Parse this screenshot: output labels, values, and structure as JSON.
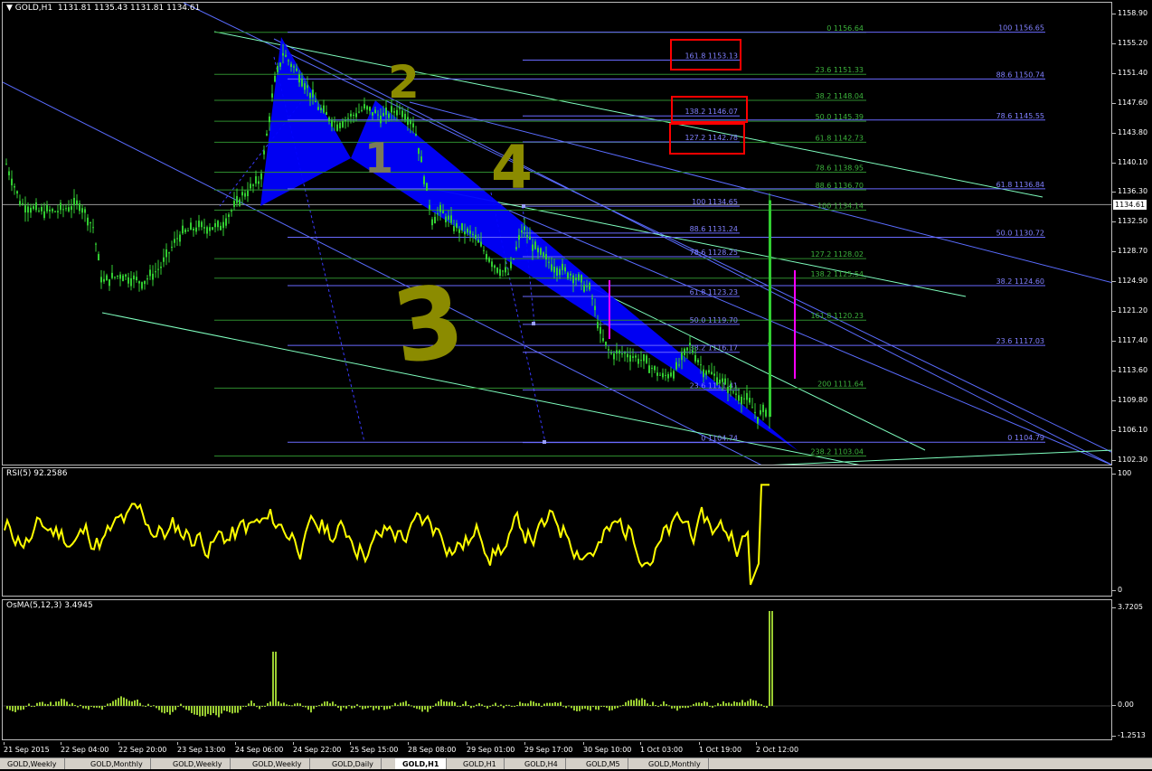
{
  "window": {
    "title": "GOLD,H1",
    "ohlc": "1131.81 1135.43 1131.81 1134.61"
  },
  "price_axis": {
    "ticks": [
      "1158.90",
      "1155.20",
      "1151.40",
      "1147.60",
      "1143.80",
      "1140.10",
      "1136.30",
      "1132.50",
      "1128.70",
      "1124.90",
      "1121.20",
      "1117.40",
      "1113.60",
      "1109.80",
      "1106.10",
      "1102.30"
    ],
    "current_price": "1134.61"
  },
  "rsi": {
    "title": "RSI(5) 92.2586",
    "max_label": "100",
    "min_label": "0",
    "color": "#ffff00"
  },
  "osma": {
    "title": "OsMA(5,12,3) 3.4945",
    "top_label": "3.7205",
    "zero_label": "0.00",
    "bottom_label": "-1.2513",
    "color": "#9acd32"
  },
  "time_axis": [
    "21 Sep 2015",
    "22 Sep 04:00",
    "22 Sep 20:00",
    "23 Sep 13:00",
    "24 Sep 06:00",
    "24 Sep 22:00",
    "25 Sep 15:00",
    "28 Sep 08:00",
    "29 Sep 01:00",
    "29 Sep 17:00",
    "30 Sep 10:00",
    "1 Oct 03:00",
    "1 Oct 19:00",
    "2 Oct 12:00"
  ],
  "fib_levels": {
    "set_a": [
      "0 1156.64",
      "23.6 1151.33",
      "38.2 1148.04",
      "50.0 1145.39",
      "61.8 1142.73",
      "78.6 1138.95",
      "88.6 1136.70",
      "100 1134.14",
      "127.2 1128.02",
      "138.2 1125.54",
      "161.8 1120.23",
      "200 1111.64",
      "238.2 1103.04"
    ],
    "set_b": [
      "100 1156.65",
      "88.6 1150.74",
      "78.6 1145.55",
      "61.8 1136.84",
      "50.0 1130.72",
      "38.2 1124.60",
      "23.6 1117.03",
      "0 1104.79"
    ],
    "set_c": [
      "161.8 1153.13",
      "138.2 1146.07",
      "127.2 1142.78",
      "100 1134.65",
      "88.6 1131.24",
      "78.6 1128.25",
      "61.8 1123.23",
      "50.0 1119.70",
      "38.2 1116.17",
      "23.6 1111.41",
      "0 1104.74"
    ]
  },
  "annotations": [
    "2",
    "1",
    "4",
    "3"
  ],
  "tabs": [
    "GOLD,Weekly",
    "GOLD,Monthly",
    "GOLD,Weekly",
    "GOLD,Weekly",
    "GOLD,Daily",
    "GOLD,H1",
    "GOLD,H1",
    "GOLD,H4",
    "GOLD,M5",
    "GOLD,Monthly"
  ],
  "active_tab": 5,
  "colors": {
    "candle": "#32cd32",
    "fib_blue": "#6a6aff",
    "fib_green": "#2e8b2e",
    "triangle": "#0000ff",
    "highlight_box": "#ff0000",
    "magenta": "#ff00ff",
    "channel_cyan": "#7fffbf",
    "annotation": "#8b8b00"
  }
}
